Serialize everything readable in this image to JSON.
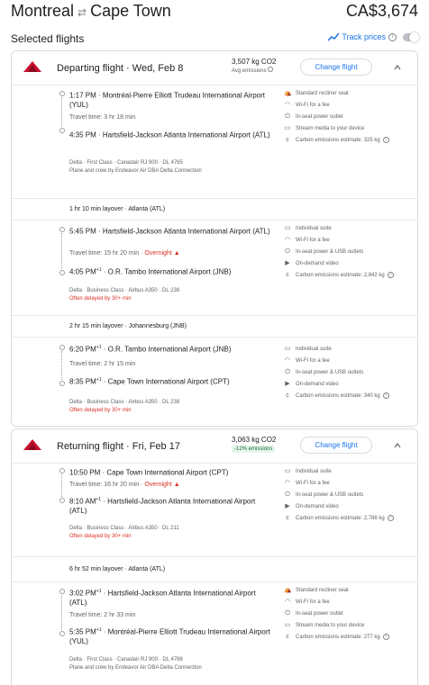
{
  "header": {
    "origin": "Montreal",
    "destination": "Cape Town",
    "price": "CA$3,674"
  },
  "subbar": {
    "selected_label": "Selected flights",
    "track_label": "Track prices"
  },
  "departing": {
    "title": "Departing flight · Wed, Feb 8",
    "co2": "3,507 kg CO2",
    "co2_sub": "Avg emissions",
    "change_label": "Change flight",
    "legs": [
      {
        "dep_time": "1:17 PM",
        "dep_sup": "",
        "dep_airport": "Montréal-Pierre Elliott Trudeau International Airport (YUL)",
        "travel": "Travel time: 3 hr 18 min",
        "overnight": "",
        "arr_time": "4:35 PM",
        "arr_sup": "",
        "arr_airport": "Hartsfield-Jackson Atlanta International Airport (ATL)",
        "meta1": "Delta · First Class · Canadair RJ 900 · DL 4765",
        "meta2": "Plane and crew by Endeavor Air DBA Delta Connection",
        "amenities": [
          "Standard recliner seat",
          "Wi-Fi for a fee",
          "In-seat power outlet",
          "Stream media to your device",
          "Carbon emissions estimate: 325 kg"
        ]
      },
      {
        "dep_time": "5:45 PM",
        "dep_sup": "",
        "dep_airport": "Hartsfield-Jackson Atlanta International Airport (ATL)",
        "travel": "Travel time: 15 hr 20 min",
        "overnight": "Overnight",
        "arr_time": "4:05 PM",
        "arr_sup": "+1",
        "arr_airport": "O.R. Tambo International Airport (JNB)",
        "meta1": "Delta · Business Class · Airbus A350 · DL 238",
        "meta2": "Often delayed by 30+ min",
        "amenities": [
          "Individual suite",
          "Wi-Fi for a fee",
          "In-seat power & USB outlets",
          "On-demand video",
          "Carbon emissions estimate: 2,842 kg"
        ]
      },
      {
        "dep_time": "6:20 PM",
        "dep_sup": "+1",
        "dep_airport": "O.R. Tambo International Airport (JNB)",
        "travel": "Travel time: 2 hr 15 min",
        "overnight": "",
        "arr_time": "8:35 PM",
        "arr_sup": "+1",
        "arr_airport": "Cape Town International Airport (CPT)",
        "meta1": "Delta · Business Class · Airbus A350 · DL 238",
        "meta2": "Often delayed by 30+ min",
        "amenities": [
          "Individual suite",
          "Wi-Fi for a fee",
          "In-seat power & USB outlets",
          "On-demand video",
          "Carbon emissions estimate: 340 kg"
        ]
      }
    ],
    "layovers": [
      "1 hr 10 min layover · Atlanta (ATL)",
      "2 hr 15 min layover · Johannesburg (JNB)"
    ]
  },
  "returning": {
    "title": "Returning flight · Fri, Feb 17",
    "co2": "3,063 kg CO2",
    "co2_badge": "-12% emissions",
    "change_label": "Change flight",
    "legs": [
      {
        "dep_time": "10:50 PM",
        "dep_sup": "",
        "dep_airport": "Cape Town International Airport (CPT)",
        "travel": "Travel time: 16 hr 20 min",
        "overnight": "Overnight",
        "arr_time": "8:10 AM",
        "arr_sup": "+1",
        "arr_airport": "Hartsfield-Jackson Atlanta International Airport (ATL)",
        "meta1": "Delta · Business Class · Airbus A350 · DL 211",
        "meta2": "Often delayed by 30+ min",
        "amenities": [
          "Individual suite",
          "Wi-Fi for a fee",
          "In-seat power & USB outlets",
          "On-demand video",
          "Carbon emissions estimate: 2,786 kg"
        ]
      },
      {
        "dep_time": "3:02 PM",
        "dep_sup": "+1",
        "dep_airport": "Hartsfield-Jackson Atlanta International Airport (ATL)",
        "travel": "Travel time: 2 hr 33 min",
        "overnight": "",
        "arr_time": "5:35 PM",
        "arr_sup": "+1",
        "arr_airport": "Montréal-Pierre Elliott Trudeau International Airport (YUL)",
        "meta1": "Delta · First Class · Canadair RJ 900 · DL 4786",
        "meta2": "Plane and crew by Endeavor Air DBA Delta Connection",
        "amenities": [
          "Standard recliner seat",
          "Wi-Fi for a fee",
          "In-seat power outlet",
          "Stream media to your device",
          "Carbon emissions estimate: 277 kg"
        ]
      }
    ],
    "layovers": [
      "6 hr 52 min layover · Atlanta (ATL)"
    ]
  },
  "colors": {
    "accent": "#1a73e8",
    "delay": "#d93025",
    "delta_red": "#c8102e",
    "eco_green": "#137333"
  }
}
